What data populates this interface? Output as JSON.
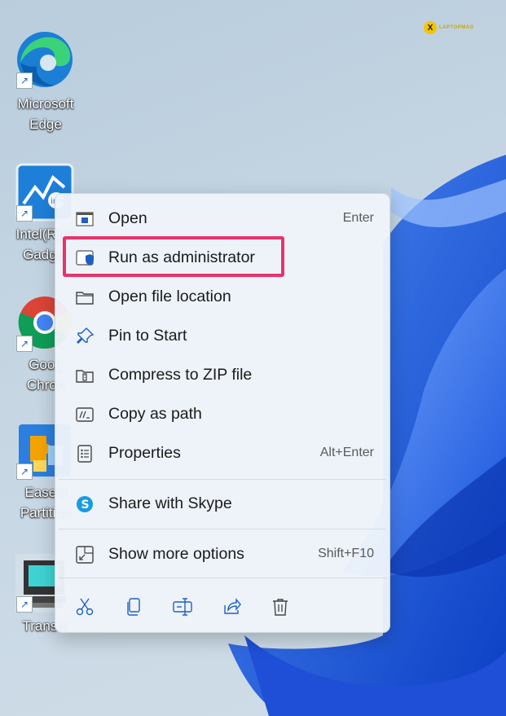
{
  "watermark": {
    "logo": "X",
    "text": "LAPTOPMAG"
  },
  "desktop": {
    "icons": [
      {
        "label_line1": "Microsoft",
        "label_line2": "Edge",
        "icon": "edge-icon"
      },
      {
        "label_line1": "Intel(R) H",
        "label_line2": "Gadget",
        "icon": "intel-gadget-icon"
      },
      {
        "label_line1": "Goog",
        "label_line2": "Chron",
        "icon": "chrome-icon"
      },
      {
        "label_line1": "EaseU",
        "label_line2": "Partition",
        "icon": "easeus-partition-icon"
      },
      {
        "label_line1": "TransM",
        "label_line2": "",
        "icon": "transmac-icon"
      }
    ]
  },
  "menu": {
    "items": [
      {
        "label": "Open",
        "shortcut": "Enter",
        "icon": "open-icon"
      },
      {
        "label": "Run as administrator",
        "shortcut": "",
        "icon": "shield-icon"
      },
      {
        "label": "Open file location",
        "shortcut": "",
        "icon": "folder-icon"
      },
      {
        "label": "Pin to Start",
        "shortcut": "",
        "icon": "pin-icon"
      },
      {
        "label": "Compress to ZIP file",
        "shortcut": "",
        "icon": "zip-folder-icon"
      },
      {
        "label": "Copy as path",
        "shortcut": "",
        "icon": "copy-path-icon"
      },
      {
        "label": "Properties",
        "shortcut": "Alt+Enter",
        "icon": "properties-icon"
      },
      {
        "label": "Share with Skype",
        "shortcut": "",
        "icon": "skype-icon"
      },
      {
        "label": "Show more options",
        "shortcut": "Shift+F10",
        "icon": "more-options-icon"
      }
    ],
    "toolbar": [
      {
        "name": "cut",
        "icon": "scissors-icon"
      },
      {
        "name": "copy",
        "icon": "copy-icon"
      },
      {
        "name": "rename",
        "icon": "rename-icon"
      },
      {
        "name": "share",
        "icon": "share-icon"
      },
      {
        "name": "delete",
        "icon": "trash-icon"
      }
    ]
  },
  "colors": {
    "highlight": "#e8336b",
    "accent": "#1f5fbf",
    "wallpaper_bloom": "#1f5fe0"
  }
}
